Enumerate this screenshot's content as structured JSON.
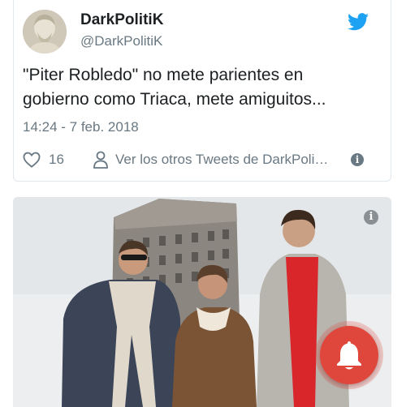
{
  "tweet": {
    "display_name": "DarkPolitiK",
    "handle": "@DarkPolitiK",
    "text": "\"Piter Robledo\" no mete parientes en gobierno como Triaca, mete amiguitos...",
    "timestamp": "14:24 - 7 feb. 2018",
    "like_count": "16",
    "more_tweets_label": "Ver los otros Tweets de DarkPoli…",
    "brand_color": "#1da1f2",
    "icons": {
      "brand": "twitter-bird-icon",
      "like": "heart-icon",
      "profile": "person-icon",
      "info": "info-icon"
    }
  },
  "photo": {
    "info_icon": "info-icon"
  },
  "notify_button": {
    "icon": "bell-icon",
    "color": "#e0473c"
  }
}
